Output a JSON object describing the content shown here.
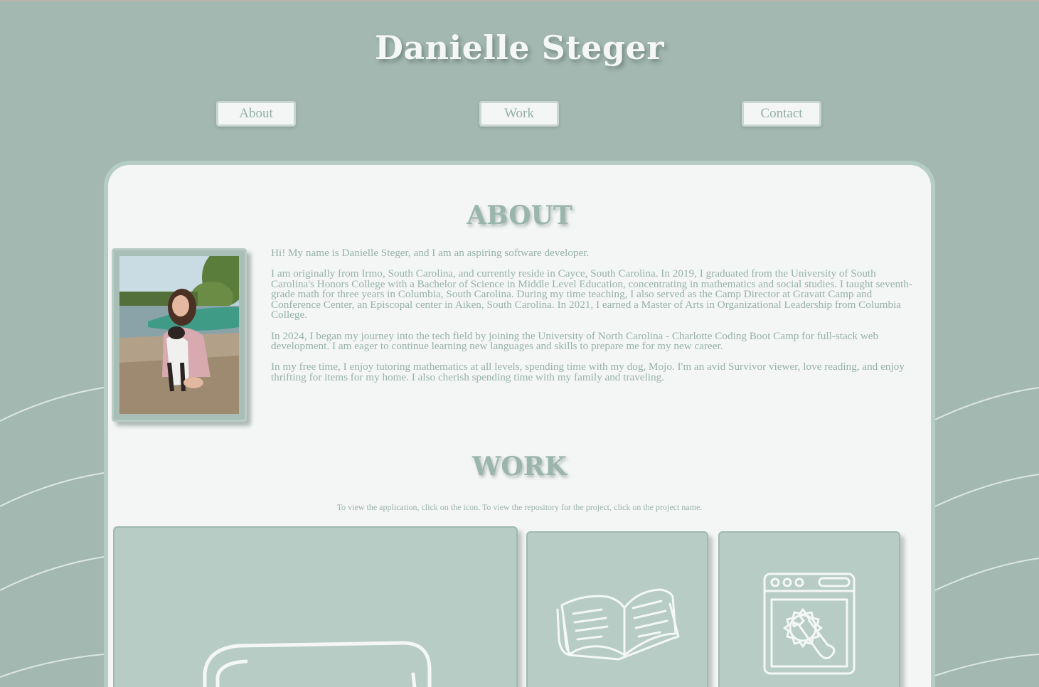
{
  "header": {
    "title": "Danielle Steger",
    "nav": [
      {
        "label": "About"
      },
      {
        "label": "Work"
      },
      {
        "label": "Contact"
      }
    ]
  },
  "about": {
    "heading": "ABOUT",
    "photo_icon": "portrait-photo",
    "paragraphs": [
      "Hi! My name is Danielle Steger, and I am an aspiring software developer.",
      "I am originally from Irmo, South Carolina, and currently reside in Cayce, South Carolina. In 2019, I graduated from the University of South Carolina's Honors College with a Bachelor of Science in Middle Level Education, concentrating in mathematics and social studies. I taught seventh-grade math for three years in Columbia, South Carolina. During my time teaching, I also served as the Camp Director at Gravatt Camp and Conference Center, an Episcopal center in Aiken, South Carolina. In 2021, I earned a Master of Arts in Organizational Leadership from Columbia College.",
      "In 2024, I began my journey into the tech field by joining the University of North Carolina - Charlotte Coding Boot Camp for full-stack web development. I am eager to continue learning new languages and skills to prepare me for my new career.",
      "In my free time, I enjoy tutoring mathematics at all levels, spending time with my dog, Mojo. I'm an avid Survivor viewer, love reading, and enjoy thrifting for items for my home. I also cherish spending time with my family and traveling."
    ]
  },
  "work": {
    "heading": "WORK",
    "subtitle": "To view the application, click on the icon. To view the repository for the project, click on the project name.",
    "projects": [
      {
        "icon": "sticky-note-icon"
      },
      {
        "icon": "open-book-icon"
      },
      {
        "icon": "browser-settings-icon"
      }
    ]
  },
  "colors": {
    "background": "#a3b8b0",
    "card": "#f4f6f5",
    "accent": "#9ab5ac",
    "tile": "#b6ccc5"
  }
}
